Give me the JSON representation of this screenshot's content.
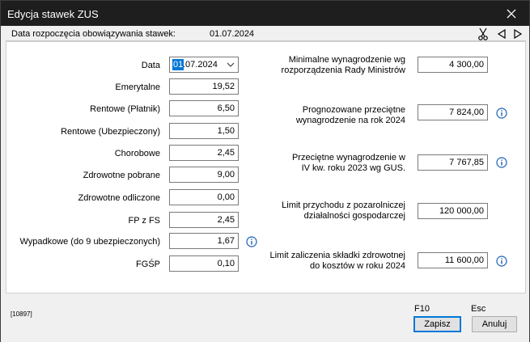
{
  "window": {
    "title": "Edycja stawek ZUS"
  },
  "info_strip": {
    "label": "Data rozpoczęcia obowiązywania stawek:",
    "value": "01.07.2024"
  },
  "left": {
    "date": {
      "label": "Data",
      "selected_part": "01",
      "rest": ".07.2024"
    },
    "emerytalne": {
      "label": "Emerytalne",
      "value": "19,52"
    },
    "rentowe_platnik": {
      "label": "Rentowe (Płatnik)",
      "value": "6,50"
    },
    "rentowe_ubezp": {
      "label": "Rentowe (Ubezpieczony)",
      "value": "1,50"
    },
    "chorobowe": {
      "label": "Chorobowe",
      "value": "2,45"
    },
    "zdrowotne_pobrane": {
      "label": "Zdrowotne pobrane",
      "value": "9,00"
    },
    "zdrowotne_odliczone": {
      "label": "Zdrowotne odliczone",
      "value": "0,00"
    },
    "fp_fs": {
      "label": "FP z FS",
      "value": "2,45"
    },
    "wypadkowe": {
      "label": "Wypadkowe (do 9 ubezpieczonych)",
      "value": "1,67"
    },
    "fgsp": {
      "label": "FGŚP",
      "value": "0,10"
    }
  },
  "right": {
    "min_wynagrodzenie": {
      "label1": "Minimalne wynagrodzenie wg",
      "label2": "rozporządzenia Rady Ministrów",
      "value": "4 300,00"
    },
    "prognozowane": {
      "label1": "Prognozowane przeciętne",
      "label2": "wynagrodzenie na rok 2024",
      "value": "7 824,00"
    },
    "przecietne": {
      "label1": "Przeciętne wynagrodzenie w",
      "label2": "IV kw. roku 2023 wg GUS.",
      "value": "7 767,85"
    },
    "limit_przychodu": {
      "label1": "Limit przychodu z pozarolniczej",
      "label2": "działalności gospodarczej",
      "value": "120 000,00"
    },
    "limit_zdrowotnej": {
      "label1": "Limit zaliczenia składki zdrowotnej",
      "label2": "do kosztów w roku 2024",
      "value": "11 600,00"
    }
  },
  "footer": {
    "code": "[10897]",
    "save_key": "F10",
    "save_label": "Zapisz",
    "cancel_key": "Esc",
    "cancel_label": "Anuluj"
  },
  "colors": {
    "titlebar": "#1e1e1e",
    "selection": "#0078d7",
    "info_icon": "#1a5fb4"
  }
}
